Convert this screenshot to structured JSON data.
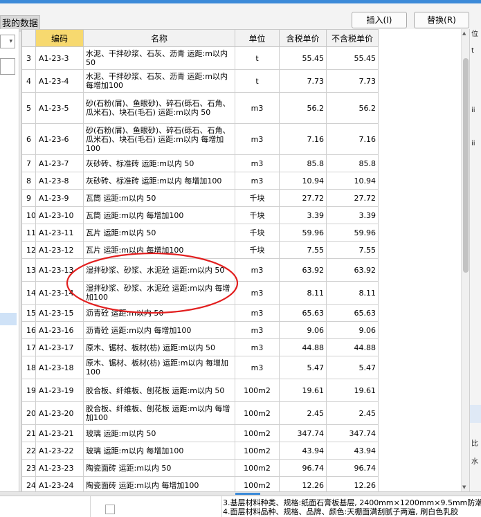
{
  "tab": {
    "label": "我的数据"
  },
  "toolbar": {
    "insert_label": "插入(I)",
    "replace_label": "替换(R)"
  },
  "table": {
    "headers": {
      "code": "编码",
      "name": "名称",
      "unit": "单位",
      "price_tax": "含税单价",
      "price_notax": "不含税单价"
    },
    "rows": [
      {
        "n": "3",
        "code": "A1-23-3",
        "name": "水泥、干拌砂浆、石灰、沥青 运距:m以内 50",
        "unit": "t",
        "p1": "55.45",
        "p2": "55.45"
      },
      {
        "n": "4",
        "code": "A1-23-4",
        "name": "水泥、干拌砂浆、石灰、沥青 运距:m以内 每增加100",
        "unit": "t",
        "p1": "7.73",
        "p2": "7.73"
      },
      {
        "n": "5",
        "code": "A1-23-5",
        "name": "砂(石粉(屑)、鱼眼砂)、碎石(砾石、石角、瓜米石)、块石(毛石) 运距:m以内 50",
        "unit": "m3",
        "p1": "56.2",
        "p2": "56.2"
      },
      {
        "n": "6",
        "code": "A1-23-6",
        "name": "砂(石粉(屑)、鱼眼砂)、碎石(砾石、石角、瓜米石)、块石(毛石) 运距:m以内 每增加100",
        "unit": "m3",
        "p1": "7.16",
        "p2": "7.16"
      },
      {
        "n": "7",
        "code": "A1-23-7",
        "name": "灰砂砖、标准砖 运距:m以内 50",
        "unit": "m3",
        "p1": "85.8",
        "p2": "85.8"
      },
      {
        "n": "8",
        "code": "A1-23-8",
        "name": "灰砂砖、标准砖 运距:m以内 每增加100",
        "unit": "m3",
        "p1": "10.94",
        "p2": "10.94"
      },
      {
        "n": "9",
        "code": "A1-23-9",
        "name": "瓦筒 运距:m以内 50",
        "unit": "千块",
        "p1": "27.72",
        "p2": "27.72"
      },
      {
        "n": "10",
        "code": "A1-23-10",
        "name": "瓦筒 运距:m以内 每增加100",
        "unit": "千块",
        "p1": "3.39",
        "p2": "3.39"
      },
      {
        "n": "11",
        "code": "A1-23-11",
        "name": "瓦片 运距:m以内 50",
        "unit": "千块",
        "p1": "59.96",
        "p2": "59.96"
      },
      {
        "n": "12",
        "code": "A1-23-12",
        "name": "瓦片 运距:m以内 每增加100",
        "unit": "千块",
        "p1": "7.55",
        "p2": "7.55"
      },
      {
        "n": "13",
        "code": "A1-23-13",
        "name": "湿拌砂浆、砂浆、水泥砼 运距:m以内 50",
        "unit": "m3",
        "p1": "63.92",
        "p2": "63.92"
      },
      {
        "n": "14",
        "code": "A1-23-14",
        "name": "湿拌砂浆、砂浆、水泥砼 运距:m以内 每增加100",
        "unit": "m3",
        "p1": "8.11",
        "p2": "8.11"
      },
      {
        "n": "15",
        "code": "A1-23-15",
        "name": "沥青砼 运距:m以内 50",
        "unit": "m3",
        "p1": "65.63",
        "p2": "65.63"
      },
      {
        "n": "16",
        "code": "A1-23-16",
        "name": "沥青砼 运距:m以内 每增加100",
        "unit": "m3",
        "p1": "9.06",
        "p2": "9.06"
      },
      {
        "n": "17",
        "code": "A1-23-17",
        "name": "原木、锯材、板材(枋) 运距:m以内 50",
        "unit": "m3",
        "p1": "44.88",
        "p2": "44.88"
      },
      {
        "n": "18",
        "code": "A1-23-18",
        "name": "原木、锯材、板材(枋) 运距:m以内 每增加100",
        "unit": "m3",
        "p1": "5.47",
        "p2": "5.47"
      },
      {
        "n": "19",
        "code": "A1-23-19",
        "name": "胶合板、纤维板、刨花板 运距:m以内 50",
        "unit": "100m2",
        "p1": "19.61",
        "p2": "19.61"
      },
      {
        "n": "20",
        "code": "A1-23-20",
        "name": "胶合板、纤维板、刨花板 运距:m以内 每增加100",
        "unit": "100m2",
        "p1": "2.45",
        "p2": "2.45"
      },
      {
        "n": "21",
        "code": "A1-23-21",
        "name": "玻璃 运距:m以内 50",
        "unit": "100m2",
        "p1": "347.74",
        "p2": "347.74"
      },
      {
        "n": "22",
        "code": "A1-23-22",
        "name": "玻璃 运距:m以内 每增加100",
        "unit": "100m2",
        "p1": "43.94",
        "p2": "43.94"
      },
      {
        "n": "23",
        "code": "A1-23-23",
        "name": "陶瓷面砖 运距:m以内 50",
        "unit": "100m2",
        "p1": "96.74",
        "p2": "96.74"
      },
      {
        "n": "24",
        "code": "A1-23-24",
        "name": "陶瓷面砖 运距:m以内 每增加100",
        "unit": "100m2",
        "p1": "12.26",
        "p2": "12.26"
      }
    ]
  },
  "bottom_note": {
    "line1": "3.基层材料种类、规格:纸面石膏板基层, 2400mm×1200mm×9.5mm防潮",
    "line2": "4.面层材料品种、规格、品牌、颜色:天棚面满刮腻子两遍, 刷白色乳胶"
  },
  "right_strip": {
    "chars": [
      "位",
      "t",
      "ii",
      "ii",
      "比",
      "水"
    ]
  },
  "colors": {
    "accent": "#3c8ad8",
    "header_highlight": "#f7d96f",
    "annotation": "#e21f1f"
  }
}
